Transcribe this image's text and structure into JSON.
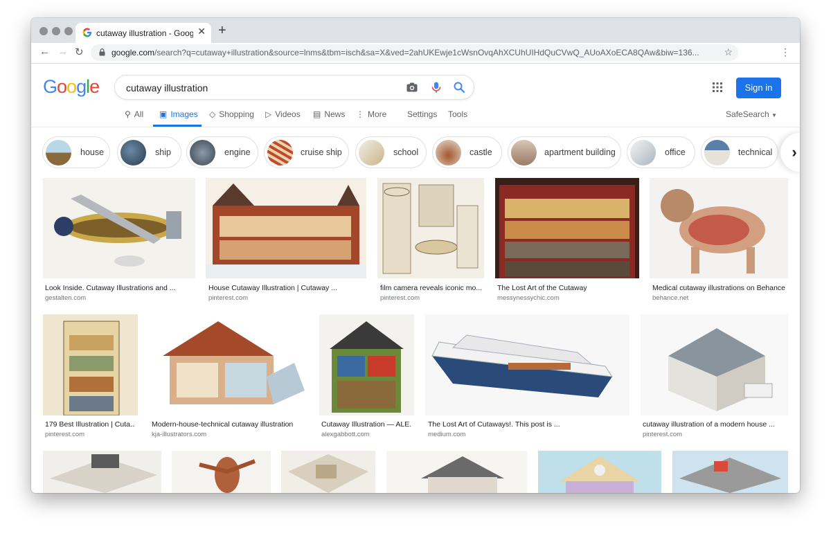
{
  "browser": {
    "tab_title": "cutaway illustration - Google S",
    "url_domain": "google.com",
    "url_path": "/search?q=cutaway+illustration&source=lnms&tbm=isch&sa=X&ved=2ahUKEwje1cWsnOvqAhXCUhUIHdQuCVwQ_AUoAXoECA8QAw&biw=136..."
  },
  "search": {
    "query": "cutaway illustration",
    "sign_in": "Sign in"
  },
  "nav": {
    "all": "All",
    "images": "Images",
    "shopping": "Shopping",
    "videos": "Videos",
    "news": "News",
    "more": "More",
    "settings": "Settings",
    "tools": "Tools",
    "safesearch": "SafeSearch"
  },
  "chips": [
    "house",
    "ship",
    "engine",
    "cruise ship",
    "school",
    "castle",
    "apartment building",
    "office",
    "technical"
  ],
  "results": [
    {
      "title": "Look Inside. Cutaway Illustrations and ...",
      "source": "gestalten.com"
    },
    {
      "title": "House Cutaway Illustration | Cutaway ...",
      "source": "pinterest.com"
    },
    {
      "title": "film camera reveals iconic mo...",
      "source": "pinterest.com"
    },
    {
      "title": "The Lost Art of the Cutaway",
      "source": "messynessychic.com"
    },
    {
      "title": "Medical cutaway illustrations on Behance",
      "source": "behance.net"
    },
    {
      "title": "179 Best Illustration | Cuta...",
      "source": "pinterest.com"
    },
    {
      "title": "Modern-house-technical cutaway illustration",
      "source": "kja-illustrators.com"
    },
    {
      "title": "Cutaway Illustration — ALE...",
      "source": "alexgabbott.com"
    },
    {
      "title": "The Lost Art of Cutaways!. This post is ...",
      "source": "medium.com"
    },
    {
      "title": "cutaway illustration of a modern house ...",
      "source": "pinterest.com"
    }
  ],
  "colors": {
    "accent": "#1a73e8",
    "logo_blue": "#4285f4",
    "logo_red": "#ea4335",
    "logo_yellow": "#fbbc05",
    "logo_green": "#34a853"
  }
}
